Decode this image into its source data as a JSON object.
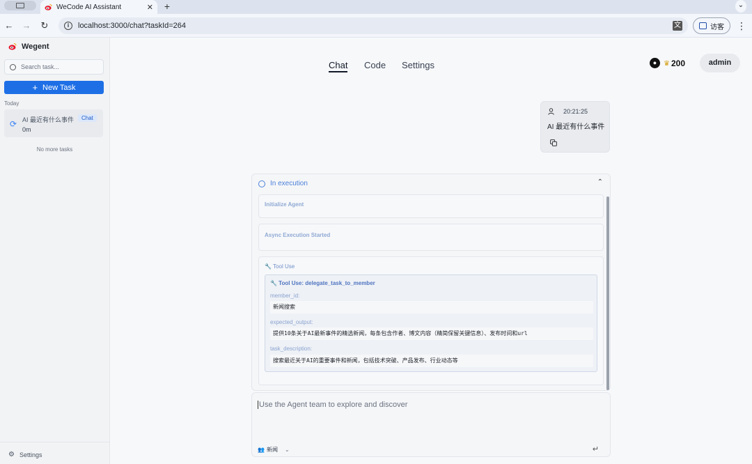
{
  "browser": {
    "tab_title": "WeCode AI Assistant",
    "tab_close": "✕",
    "new_tab": "+",
    "url": "localhost:3000/chat?taskId=264",
    "profile_label": "访客"
  },
  "sidebar": {
    "brand": "Wegent",
    "search_placeholder": "Search task...",
    "new_task_label": "New Task",
    "section_today": "Today",
    "tasks": [
      {
        "title": "AI 最近有什么事件",
        "time": "0m",
        "badge": "Chat"
      }
    ],
    "no_more": "No more tasks",
    "settings_label": "Settings"
  },
  "header": {
    "tabs": [
      {
        "label": "Chat",
        "active": true
      },
      {
        "label": "Code",
        "active": false
      },
      {
        "label": "Settings",
        "active": false
      }
    ],
    "stars": "200",
    "user": "admin"
  },
  "message": {
    "time": "20:21:25",
    "text": "AI 最近有什么事件"
  },
  "execution": {
    "status": "In execution",
    "steps": [
      {
        "title": "Initialize Agent"
      },
      {
        "title": "Async Execution Started"
      },
      {
        "title": "🔧 Tool Use"
      }
    ],
    "tool": {
      "title": "🔧 Tool Use: delegate_task_to_member",
      "params": [
        {
          "label": "member_id:",
          "value": "新闻搜索"
        },
        {
          "label": "expected_output:",
          "value": "提供10条关于AI最新事件的精选新闻，每条包含作者、博文内容（精简保留关键信息）、发布时间和url"
        },
        {
          "label": "task_description:",
          "value": "搜索最近关于AI的重要事件和新闻，包括技术突破、产品发布、行业动态等"
        }
      ]
    }
  },
  "composer": {
    "placeholder": "Use the Agent team to explore and discover",
    "team": "新闻"
  },
  "colors": {
    "accent": "#1e6fe6",
    "exec_blue": "#4a80d9"
  }
}
